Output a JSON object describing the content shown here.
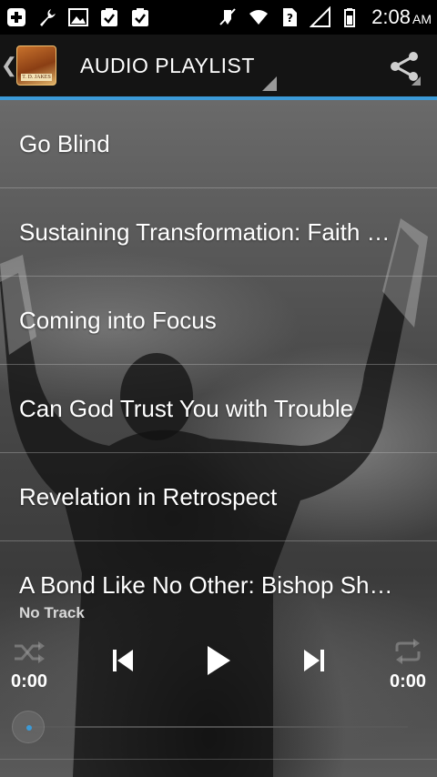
{
  "status_bar": {
    "left_icons": [
      "add-icon",
      "wrench-icon",
      "image-icon",
      "clipboard-check-icon",
      "clipboard-check-icon"
    ],
    "right_icons": [
      "mute-icon",
      "wifi-icon",
      "no-sim-icon",
      "signal-icon",
      "battery-icon"
    ],
    "time": "2:08",
    "ampm": "AM"
  },
  "action_bar": {
    "title": "AUDIO PLAYLIST",
    "app_icon_caption": "T. D. JAKES",
    "share_icon": "share-icon"
  },
  "playlist": {
    "items": [
      {
        "label": "Go Blind"
      },
      {
        "label": "Sustaining Transformation: Faith Works"
      },
      {
        "label": "Coming into Focus"
      },
      {
        "label": "Can God Trust You with Trouble"
      },
      {
        "label": "Revelation in Retrospect"
      },
      {
        "label": "A Bond Like No Other: Bishop Sh…"
      }
    ]
  },
  "player": {
    "track_title": "No Track",
    "elapsed": "0:00",
    "duration": "0:00",
    "progress": 0,
    "controls": [
      "shuffle-icon",
      "previous-icon",
      "play-icon",
      "next-icon",
      "repeat-icon"
    ]
  },
  "colors": {
    "accent": "#3c9ad7",
    "status_bar": "#000000",
    "action_bar": "#141414"
  }
}
